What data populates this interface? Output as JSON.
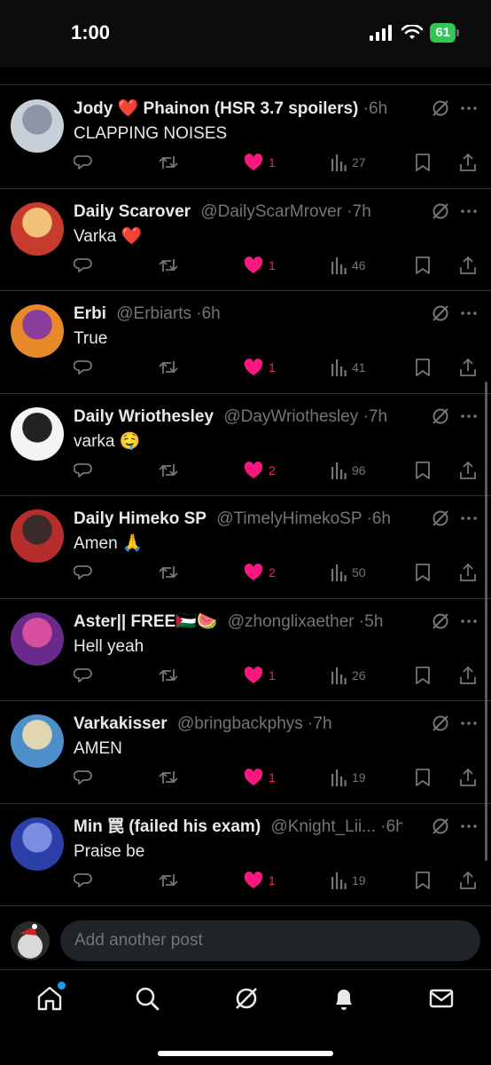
{
  "status_bar": {
    "time": "1:00",
    "battery": "61"
  },
  "posts": [
    {
      "name": "Jody ❤️ Phainon (HSR 3.7 spoilers)",
      "handle": "",
      "age": "6h",
      "text": "CLAPPING NOISES",
      "likes": "1",
      "views": "27",
      "avatar_colors": [
        "#c9cfd8",
        "#8d96a6"
      ]
    },
    {
      "name": "Daily Scarover",
      "handle": "@DailyScarMrover",
      "age": "7h",
      "text": "Varka ❤️",
      "likes": "1",
      "views": "46",
      "avatar_colors": [
        "#c73b2f",
        "#f0c27a"
      ]
    },
    {
      "name": "Erbi",
      "handle": "@Erbiarts",
      "age": "6h",
      "text": "True",
      "likes": "1",
      "views": "41",
      "avatar_colors": [
        "#e98a2a",
        "#8a3d9a"
      ]
    },
    {
      "name": "Daily Wriothesley",
      "handle": "@DayWriothesley",
      "age": "7h",
      "text": "varka 🤤",
      "likes": "2",
      "views": "96",
      "avatar_colors": [
        "#f4f4f4",
        "#222"
      ]
    },
    {
      "name": "Daily Himeko SP",
      "handle": "@TimelyHimekoSP",
      "age": "6h",
      "text": "Amen 🙏",
      "likes": "2",
      "views": "50",
      "avatar_colors": [
        "#b52d2d",
        "#3b2a2a"
      ]
    },
    {
      "name": "Aster|| FREE🇵🇸🍉",
      "handle": "@zhonglixaether",
      "age": "5h",
      "text": "Hell yeah",
      "likes": "1",
      "views": "26",
      "avatar_colors": [
        "#6a2a8c",
        "#d84fa0"
      ]
    },
    {
      "name": "Varkakisser",
      "handle": "@bringbackphys",
      "age": "7h",
      "text": "AMEN",
      "likes": "1",
      "views": "19",
      "avatar_colors": [
        "#4d8fc9",
        "#e2d6b0"
      ]
    },
    {
      "name": "Min 罠 (failed his exam)",
      "handle": "@Knight_Lii...",
      "age": "6h",
      "text": "Praise be",
      "likes": "1",
      "views": "19",
      "avatar_colors": [
        "#2b3fa8",
        "#7a8de0"
      ]
    }
  ],
  "composer": {
    "placeholder": "Add another post"
  },
  "colors": {
    "like": "#f91880",
    "muted": "#71767b",
    "text": "#e7e9ea",
    "accent": "#1d9bf0"
  },
  "icons": {
    "reply": "comment-bubble-icon",
    "repost": "repost-arrows-icon",
    "like": "heart-icon",
    "views": "bar-chart-icon",
    "bookmark": "bookmark-icon",
    "share": "share-upload-icon",
    "grok": "grok-slash-circle-icon",
    "more": "more-dots-icon"
  },
  "tabs": [
    "home",
    "search",
    "grok",
    "notifications",
    "messages"
  ]
}
